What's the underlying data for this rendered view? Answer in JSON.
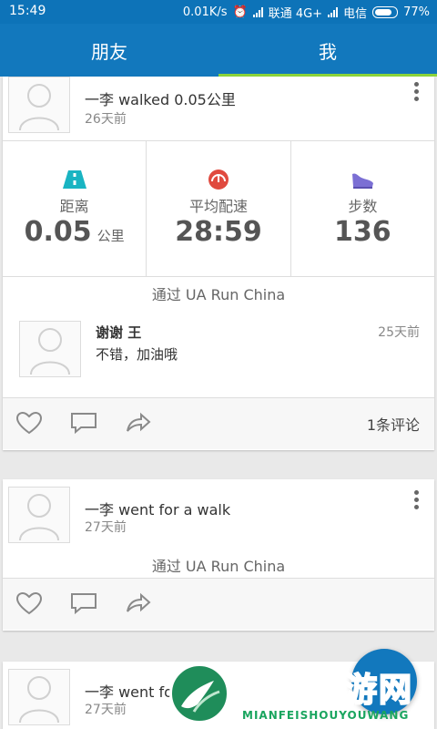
{
  "status_bar": {
    "time": "15:49",
    "speed": "0.01K/s",
    "carrier1": "联通 4G+",
    "carrier2": "电信",
    "battery": "77%"
  },
  "tabs": [
    {
      "label": "朋友",
      "active": false
    },
    {
      "label": "我",
      "active": true
    }
  ],
  "posts": [
    {
      "title": "一李 walked 0.05公里",
      "date": "26天前",
      "stats": [
        {
          "icon": "road-icon",
          "label": "距离",
          "value": "0.05",
          "unit": "公里"
        },
        {
          "icon": "speedometer-icon",
          "label": "平均配速",
          "value": "28:59",
          "unit": ""
        },
        {
          "icon": "shoe-icon",
          "label": "步数",
          "value": "136",
          "unit": ""
        }
      ],
      "via": "通过 UA Run China",
      "comment": {
        "name": "谢谢 王",
        "text": "不错，加油哦",
        "time": "25天前"
      },
      "comment_count": "1条评论"
    },
    {
      "title": "一李 went for a walk",
      "date": "27天前",
      "via": "通过 UA Run China"
    },
    {
      "title": "一李 went fo",
      "date": "27天前"
    }
  ],
  "watermark": {
    "title": "免费手游网",
    "subtitle": "MIANFEISHOUYOUWANG"
  },
  "colors": {
    "header_blue": "#1278bd",
    "tab_indicator": "#8bd43a",
    "road_teal": "#19b4c2",
    "speed_red": "#e04a3f",
    "shoe_purple": "#7b6fd4"
  }
}
